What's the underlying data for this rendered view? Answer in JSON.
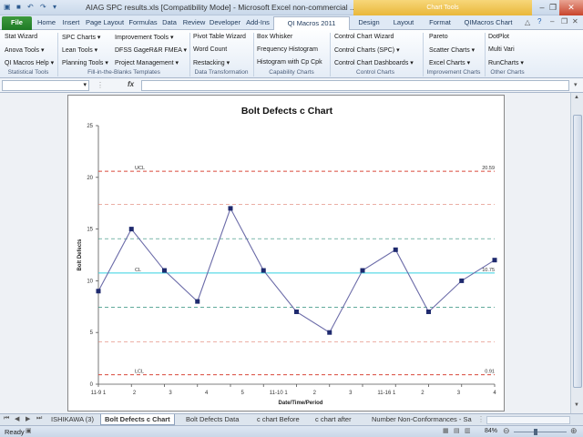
{
  "window": {
    "title": "AIAG SPC results.xls  [Compatibility Mode]  -  Microsoft Excel non-commercial ...",
    "context_tab_group": "Chart Tools"
  },
  "ribbon_tabs": [
    "File",
    "Home",
    "Insert",
    "Page Layout",
    "Formulas",
    "Data",
    "Review",
    "Developer",
    "Add-Ins",
    "QI Macros 2011",
    "Design",
    "Layout",
    "Format",
    "QIMacros Chart"
  ],
  "ribbon": {
    "statistical_tools": {
      "items": [
        "Stat Wizard",
        "Anova Tools ▾",
        "QI Macros Help ▾"
      ],
      "label": "Statistical Tools"
    },
    "fill_in": {
      "col1": [
        "SPC Charts ▾",
        "Lean Tools ▾",
        "Planning Tools ▾"
      ],
      "col2": [
        "Improvement Tools ▾",
        "DFSS GageR&R FMEA ▾",
        "Project Management ▾"
      ],
      "label": "Fill-in-the-Blanks Templates"
    },
    "data_transformation": {
      "items": [
        "Pivot Table Wizard",
        "Word Count",
        "Restacking ▾"
      ],
      "label": "Data Transformation"
    },
    "capability": {
      "items": [
        "Box Whisker",
        "Frequency Histogram",
        "Histogram with Cp Cpk"
      ],
      "label": "Capability Charts"
    },
    "control": {
      "items": [
        "Control Chart Wizard",
        "Control Charts (SPC) ▾",
        "Control Chart Dashboards ▾"
      ],
      "label": "Control Charts"
    },
    "improvement": {
      "items": [
        "Pareto",
        "Scatter Charts ▾",
        "Excel Charts ▾"
      ],
      "label": "Improvement Charts"
    },
    "other": {
      "items": [
        "DotPlot",
        "Multi Vari",
        "RunCharts ▾"
      ],
      "label": "Other Charts"
    }
  },
  "formula_bar": {
    "name_box": "",
    "fx": "fx",
    "formula": ""
  },
  "chart_data": {
    "type": "line",
    "title": "Bolt Defects c Chart",
    "xlabel": "Date/Time/Period",
    "ylabel": "Bolt Defects",
    "categories": [
      "11-9 1",
      "2",
      "3",
      "4",
      "5",
      "11-10 1",
      "2",
      "3",
      "4",
      "11-16 1",
      "2",
      "3",
      "4"
    ],
    "tick_labels": [
      "11-9 1",
      "2",
      "3",
      "4",
      "5",
      "11-10 1",
      "2",
      "3",
      "11-16 1",
      "2",
      "3",
      "4"
    ],
    "values": [
      9,
      15,
      11,
      8,
      17,
      11,
      7,
      5,
      11,
      13,
      7,
      10,
      12
    ],
    "ylim": [
      0,
      25
    ],
    "yticks": [
      0,
      5,
      10,
      15,
      20,
      25
    ],
    "ucl": {
      "label": "UCL",
      "value": 20.59,
      "value_text": "20.59"
    },
    "cl": {
      "label": "CL",
      "value": 10.75,
      "value_text": "10.75"
    },
    "lcl": {
      "label": "LCL",
      "value": 0.91,
      "value_text": "0.91"
    },
    "sigma_lines": [
      4.11,
      7.43,
      14.07,
      17.39
    ],
    "colors": {
      "series": "#6b6ba8",
      "marker": "#1f2a6e",
      "limit": "#d9473a",
      "center": "#33d0e0",
      "sigma1": "#2d8e7a",
      "sigma2": "#e08070"
    }
  },
  "sheet_tabs": [
    "ISHIKAWA (3)",
    "Bolt Defects c Chart",
    "Bolt Defects Data",
    "c chart Before",
    "c chart after",
    "Number Non-Conformances - Sa"
  ],
  "active_sheet": "Bolt Defects c Chart",
  "status": {
    "left": "Ready",
    "zoom": "84%"
  }
}
